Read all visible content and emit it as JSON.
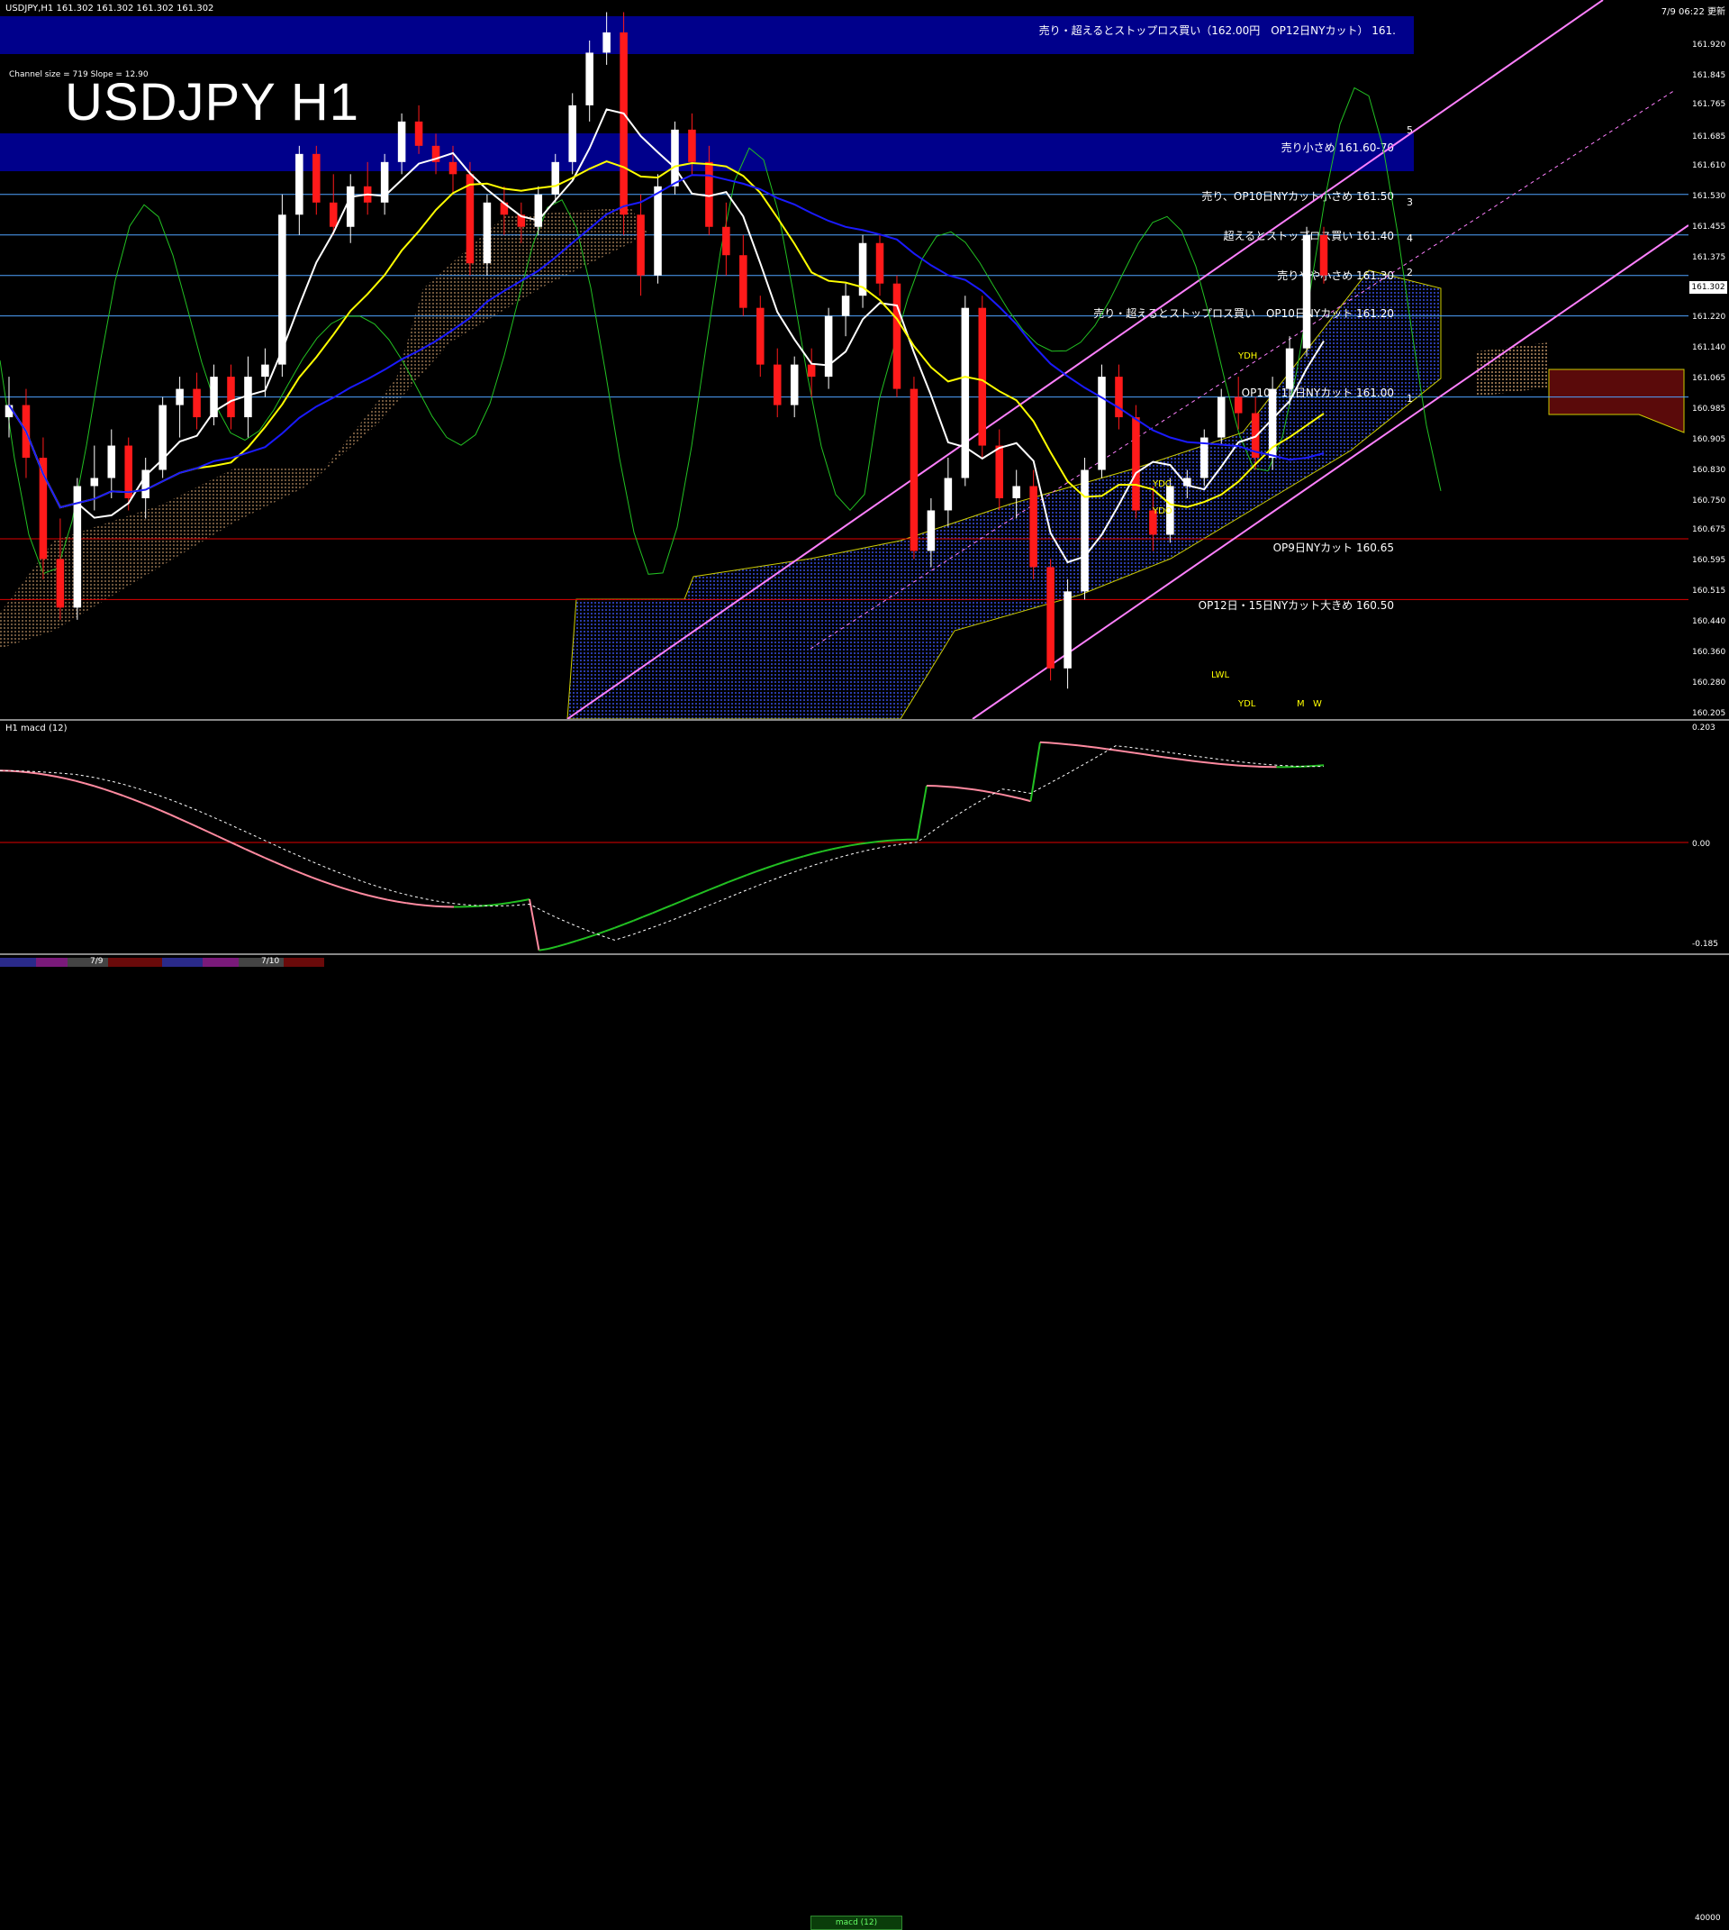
{
  "header": {
    "symbol": "USDJPY,H1  161.302 161.302 161.302 161.302",
    "timestamp": "7/9 06:22 更新",
    "title": "USDJPY H1",
    "channel_info": "Channel size = 719 Slope = 12.90",
    "macd_label": "H1  macd (12)"
  },
  "colors": {
    "bg": "#000000",
    "bull": "#ffffff",
    "bear": "#ff1a1a",
    "band": "#00008b",
    "ma_white": "#ffffff",
    "ma_yellow": "#ffff00",
    "ma_blue": "#1a1aff",
    "green": "#22c022",
    "pink": "#ff80ff",
    "hline_blue": "#4fa3ff",
    "hline_red": "#e00000",
    "cloud": "#0a1a6a"
  },
  "levels": [
    {
      "label": "売り・超えるとストップロス買い（162.00円　OP12日NYカット） 161.",
      "color": "#ffffff",
      "band": true
    },
    {
      "label": "売り小さめ 161.60-70",
      "color": "#ffffff",
      "band": true
    },
    {
      "label": "売り、OP10日NYカット小さめ 161.50",
      "color": "#ffffff",
      "band": false
    },
    {
      "label": "超えるとストップロス買い 161.40",
      "color": "#ffffff",
      "band": false
    },
    {
      "label": "売りやや小さめ 161.30",
      "color": "#ffffff",
      "band": false
    },
    {
      "label": "売り・超えるとストップロス買い　OP10日NYカット 161.20",
      "color": "#ffffff",
      "band": false
    },
    {
      "label": "OP10・11日NYカット 161.00",
      "color": "#ffffff",
      "band": false
    },
    {
      "label": "OP9日NYカット 160.65",
      "color": "#ffffff",
      "band": false
    },
    {
      "label": "OP12日・15日NYカット大きめ 160.50",
      "color": "#ffffff",
      "band": false
    }
  ],
  "level_prices": [
    162.0,
    161.65,
    161.5,
    161.4,
    161.3,
    161.2,
    161.0,
    160.65,
    160.5
  ],
  "fan_labels": [
    "5",
    "3",
    "4",
    "2",
    "1"
  ],
  "small_labels": [
    "YDH",
    "YDC",
    "YDO",
    "LWL",
    "YDL",
    "M",
    "W"
  ],
  "axis_main": [
    "161.920",
    "161.845",
    "161.765",
    "161.685",
    "161.610",
    "161.530",
    "161.455",
    "161.375",
    "161.302",
    "161.220",
    "161.140",
    "161.065",
    "160.985",
    "160.905",
    "160.830",
    "160.750",
    "160.675",
    "160.595",
    "160.515",
    "160.440",
    "160.360",
    "160.280",
    "160.205"
  ],
  "axis_macd": [
    "0.203",
    "0.00",
    "-0.185"
  ],
  "current_price": "161.302",
  "bottom": {
    "dates": [
      "7/9",
      "7/10"
    ],
    "macd_tab": "macd (12)",
    "volume": "40000"
  },
  "chart_data": {
    "type": "candlestick",
    "symbol": "USDJPY",
    "timeframe": "H1",
    "ylim": [
      160.205,
      161.98
    ],
    "macd_ylim": [
      -0.185,
      0.203
    ],
    "macd_series_names": [],
    "candles": [
      [
        160.95,
        161.05,
        160.9,
        160.98
      ],
      [
        160.98,
        161.02,
        160.8,
        160.85
      ],
      [
        160.85,
        160.9,
        160.55,
        160.6
      ],
      [
        160.6,
        160.7,
        160.45,
        160.48
      ],
      [
        160.48,
        160.8,
        160.45,
        160.78
      ],
      [
        160.78,
        160.88,
        160.72,
        160.8
      ],
      [
        160.8,
        160.92,
        160.75,
        160.88
      ],
      [
        160.88,
        160.9,
        160.72,
        160.75
      ],
      [
        160.75,
        160.85,
        160.7,
        160.82
      ],
      [
        160.82,
        161.0,
        160.8,
        160.98
      ],
      [
        160.98,
        161.05,
        160.9,
        161.02
      ],
      [
        161.02,
        161.06,
        160.92,
        160.95
      ],
      [
        160.95,
        161.08,
        160.93,
        161.05
      ],
      [
        161.05,
        161.08,
        160.92,
        160.95
      ],
      [
        160.95,
        161.1,
        160.9,
        161.05
      ],
      [
        161.05,
        161.12,
        161.0,
        161.08
      ],
      [
        161.08,
        161.5,
        161.05,
        161.45
      ],
      [
        161.45,
        161.62,
        161.4,
        161.6
      ],
      [
        161.6,
        161.62,
        161.45,
        161.48
      ],
      [
        161.48,
        161.55,
        161.4,
        161.42
      ],
      [
        161.42,
        161.55,
        161.38,
        161.52
      ],
      [
        161.52,
        161.58,
        161.45,
        161.48
      ],
      [
        161.48,
        161.6,
        161.45,
        161.58
      ],
      [
        161.58,
        161.7,
        161.55,
        161.68
      ],
      [
        161.68,
        161.72,
        161.6,
        161.62
      ],
      [
        161.62,
        161.65,
        161.55,
        161.58
      ],
      [
        161.58,
        161.62,
        161.5,
        161.55
      ],
      [
        161.55,
        161.58,
        161.3,
        161.33
      ],
      [
        161.33,
        161.5,
        161.3,
        161.48
      ],
      [
        161.48,
        161.52,
        161.4,
        161.45
      ],
      [
        161.45,
        161.48,
        161.38,
        161.42
      ],
      [
        161.42,
        161.52,
        161.4,
        161.5
      ],
      [
        161.5,
        161.6,
        161.48,
        161.58
      ],
      [
        161.58,
        161.75,
        161.55,
        161.72
      ],
      [
        161.72,
        161.88,
        161.68,
        161.85
      ],
      [
        161.85,
        161.95,
        161.82,
        161.9
      ],
      [
        161.9,
        161.95,
        161.4,
        161.45
      ],
      [
        161.45,
        161.5,
        161.25,
        161.3
      ],
      [
        161.3,
        161.55,
        161.28,
        161.52
      ],
      [
        161.52,
        161.68,
        161.5,
        161.66
      ],
      [
        161.66,
        161.7,
        161.55,
        161.58
      ],
      [
        161.58,
        161.62,
        161.4,
        161.42
      ],
      [
        161.42,
        161.48,
        161.3,
        161.35
      ],
      [
        161.35,
        161.4,
        161.2,
        161.22
      ],
      [
        161.22,
        161.25,
        161.05,
        161.08
      ],
      [
        161.08,
        161.12,
        160.95,
        160.98
      ],
      [
        160.98,
        161.1,
        160.95,
        161.08
      ],
      [
        161.08,
        161.12,
        161.0,
        161.05
      ],
      [
        161.05,
        161.22,
        161.02,
        161.2
      ],
      [
        161.2,
        161.28,
        161.15,
        161.25
      ],
      [
        161.25,
        161.4,
        161.22,
        161.38
      ],
      [
        161.38,
        161.4,
        161.25,
        161.28
      ],
      [
        161.28,
        161.3,
        161.0,
        161.02
      ],
      [
        161.02,
        161.05,
        160.6,
        160.62
      ],
      [
        160.62,
        160.75,
        160.58,
        160.72
      ],
      [
        160.72,
        160.85,
        160.68,
        160.8
      ],
      [
        160.8,
        161.25,
        160.78,
        161.22
      ],
      [
        161.22,
        161.25,
        160.85,
        160.88
      ],
      [
        160.88,
        160.92,
        160.72,
        160.75
      ],
      [
        160.75,
        160.82,
        160.7,
        160.78
      ],
      [
        160.78,
        160.82,
        160.55,
        160.58
      ],
      [
        160.58,
        160.6,
        160.3,
        160.33
      ],
      [
        160.33,
        160.55,
        160.28,
        160.52
      ],
      [
        160.52,
        160.85,
        160.5,
        160.82
      ],
      [
        160.82,
        161.08,
        160.8,
        161.05
      ],
      [
        161.05,
        161.08,
        160.92,
        160.95
      ],
      [
        160.95,
        160.98,
        160.7,
        160.72
      ],
      [
        160.72,
        160.78,
        160.62,
        160.66
      ],
      [
        160.66,
        160.8,
        160.64,
        160.78
      ],
      [
        160.78,
        160.82,
        160.75,
        160.8
      ],
      [
        160.8,
        160.92,
        160.78,
        160.9
      ],
      [
        160.9,
        161.02,
        160.88,
        161.0
      ],
      [
        161.0,
        161.05,
        160.92,
        160.96
      ],
      [
        160.96,
        161.0,
        160.82,
        160.85
      ],
      [
        160.85,
        161.05,
        160.82,
        161.02
      ],
      [
        161.02,
        161.15,
        160.98,
        161.12
      ],
      [
        161.12,
        161.42,
        161.1,
        161.4
      ],
      [
        161.4,
        161.42,
        161.28,
        161.3
      ]
    ]
  }
}
